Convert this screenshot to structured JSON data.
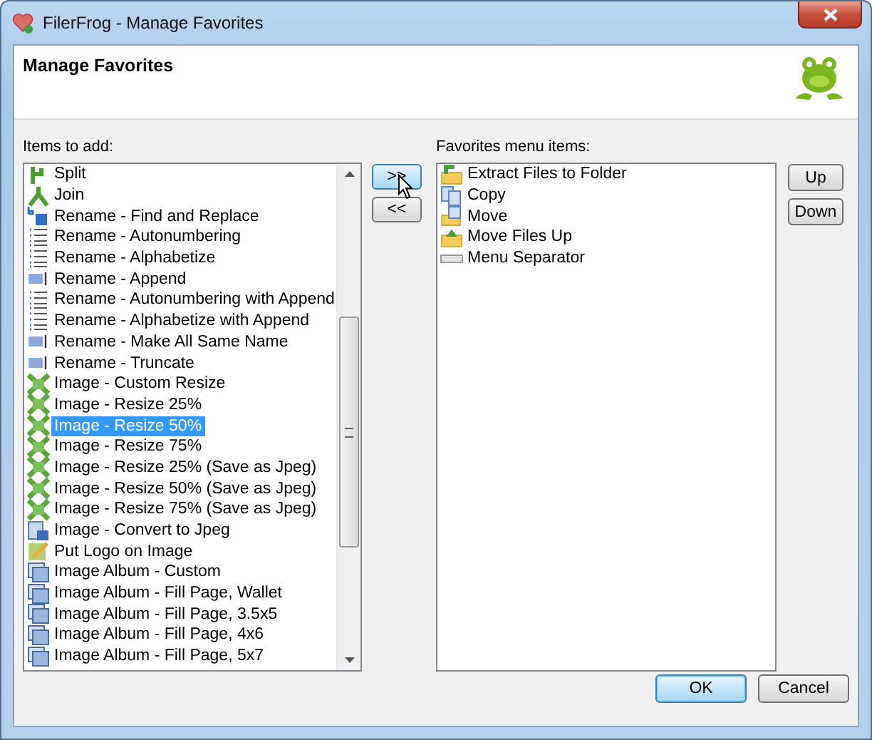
{
  "window": {
    "title": "FilerFrog - Manage Favorites"
  },
  "header": {
    "title": "Manage Favorites"
  },
  "items_to_add": {
    "label": "Items to add:",
    "items": [
      {
        "kind": "split",
        "text": "Split",
        "selected": false
      },
      {
        "kind": "join",
        "text": "Join",
        "selected": false
      },
      {
        "kind": "replace",
        "text": "Rename - Find and Replace",
        "selected": false
      },
      {
        "kind": "list",
        "text": "Rename - Autonumbering",
        "selected": false
      },
      {
        "kind": "list",
        "text": "Rename - Alphabetize",
        "selected": false
      },
      {
        "kind": "append",
        "text": "Rename - Append",
        "selected": false
      },
      {
        "kind": "list",
        "text": "Rename - Autonumbering with Append",
        "selected": false
      },
      {
        "kind": "list",
        "text": "Rename - Alphabetize with Append",
        "selected": false
      },
      {
        "kind": "append",
        "text": "Rename - Make All Same Name",
        "selected": false
      },
      {
        "kind": "append",
        "text": "Rename - Truncate",
        "selected": false
      },
      {
        "kind": "resize",
        "text": "Image - Custom Resize",
        "selected": false
      },
      {
        "kind": "resize",
        "text": "Image - Resize 25%",
        "selected": false
      },
      {
        "kind": "resize",
        "text": "Image - Resize 50%",
        "selected": true
      },
      {
        "kind": "resize",
        "text": "Image - Resize 75%",
        "selected": false
      },
      {
        "kind": "resize",
        "text": "Image - Resize 25% (Save as Jpeg)",
        "selected": false
      },
      {
        "kind": "resize",
        "text": "Image - Resize 50% (Save as Jpeg)",
        "selected": false
      },
      {
        "kind": "resize",
        "text": "Image - Resize 75% (Save as Jpeg)",
        "selected": false
      },
      {
        "kind": "convert",
        "text": "Image - Convert to Jpeg",
        "selected": false
      },
      {
        "kind": "logo",
        "text": "Put Logo on Image",
        "selected": false
      },
      {
        "kind": "album",
        "text": "Image Album - Custom",
        "selected": false
      },
      {
        "kind": "album",
        "text": "Image Album - Fill Page, Wallet",
        "selected": false
      },
      {
        "kind": "album",
        "text": "Image Album - Fill Page, 3.5x5",
        "selected": false
      },
      {
        "kind": "album",
        "text": "Image Album - Fill Page, 4x6",
        "selected": false
      },
      {
        "kind": "album",
        "text": "Image Album - Fill Page, 5x7",
        "selected": false
      }
    ]
  },
  "add_button": ">>",
  "remove_button": "<<",
  "favorites": {
    "label": "Favorites menu items:",
    "items": [
      {
        "kind": "extract",
        "text": "Extract Files to Folder"
      },
      {
        "kind": "copy",
        "text": "Copy"
      },
      {
        "kind": "move",
        "text": "Move"
      },
      {
        "kind": "moveup",
        "text": "Move Files Up"
      },
      {
        "kind": "separator",
        "text": "Menu Separator"
      }
    ]
  },
  "up_button": "Up",
  "down_button": "Down",
  "buttons": [
    "OK",
    "Cancel"
  ]
}
